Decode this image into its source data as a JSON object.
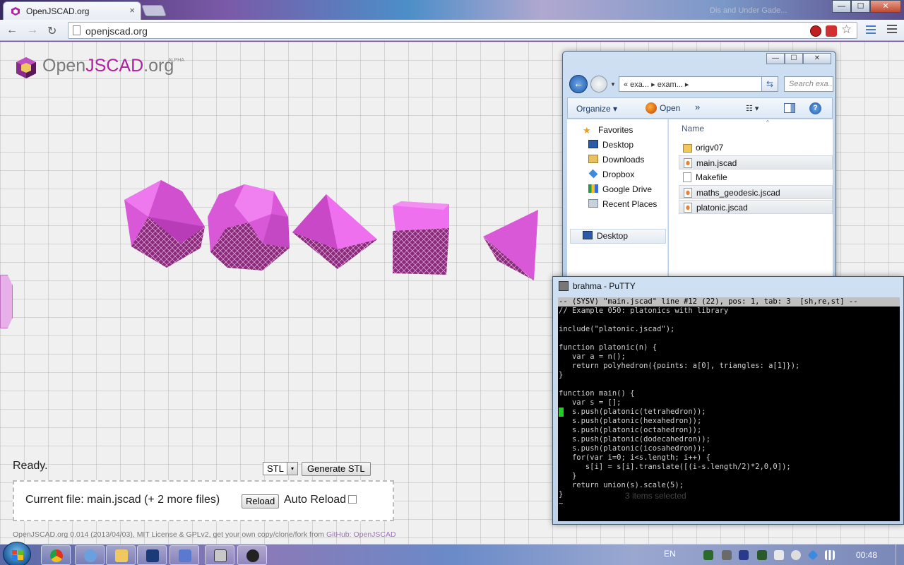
{
  "browser": {
    "tab_title": "OpenJSCAD.org",
    "tab_close": "×",
    "ghost_tab_title": "Dis and Under Gade...",
    "url": "openjscad.org",
    "window_controls": {
      "minimize": "—",
      "maximize": "☐",
      "close": "✕"
    },
    "nav": {
      "back": "←",
      "forward": "→",
      "reload": "↻"
    },
    "star": "☆",
    "extensions": [
      "abp-icon",
      "stop-icon"
    ]
  },
  "app": {
    "logo_prefix": "Open",
    "logo_highlight": "JSCAD",
    "logo_suffix": ".org",
    "logo_badge": "ALPHA",
    "status": "Ready.",
    "format_value": "STL",
    "format_arrow": "▾",
    "generate_label": "Generate STL",
    "current_file": "Current file: main.jscad (+ 2 more files)",
    "reload_label": "Reload",
    "auto_reload_label": "Auto Reload",
    "footer_text": "OpenJSCAD.org 0.014 (2013/04/03), MIT License & GPLv2, get your own copy/clone/fork from ",
    "footer_link": "GitHub: OpenJSCAD",
    "colors": {
      "accent": "#b020a0",
      "shape": "#e060e0"
    }
  },
  "explorer": {
    "controls": {
      "minimize": "—",
      "maximize": "☐",
      "close": "✕"
    },
    "back": "←",
    "address": "«    exa...  ▸   exam...  ▸",
    "refresh": "⇆",
    "search_placeholder": "Search exa...",
    "organize": "Organize ▾",
    "open": "Open",
    "more": "»",
    "views": "☷  ▾",
    "help": "?",
    "nav_items": [
      {
        "label": "Favorites",
        "icon": "star-icon"
      },
      {
        "label": "Desktop",
        "icon": "desktop-icon"
      },
      {
        "label": "Downloads",
        "icon": "downloads-icon"
      },
      {
        "label": "Dropbox",
        "icon": "dropbox-icon"
      },
      {
        "label": "Google Drive",
        "icon": "google-drive-icon"
      },
      {
        "label": "Recent Places",
        "icon": "recent-places-icon"
      },
      {
        "label": "Desktop",
        "icon": "desktop-icon"
      }
    ],
    "column_name": "Name",
    "sort_arrow": "^",
    "files": [
      {
        "name": "origv07",
        "type": "folder"
      },
      {
        "name": "main.jscad",
        "type": "jscad"
      },
      {
        "name": "Makefile",
        "type": "file"
      },
      {
        "name": "maths_geodesic.jscad",
        "type": "jscad"
      },
      {
        "name": "platonic.jscad",
        "type": "jscad"
      }
    ]
  },
  "putty": {
    "title": "brahma - PuTTY",
    "status_line": "-- (SYSV) \"main.jscad\" line #12 (22), pos: 1, tab: 3  [sh,re,st] --",
    "lines": [
      "// Example 050: platonics with library",
      "",
      "include(\"platonic.jscad\");",
      "",
      "function platonic(n) {",
      "   var a = n();",
      "   return polyhedron({points: a[0], triangles: a[1]});",
      "}",
      "",
      "function main() {",
      "   var s = [];",
      "   s.push(platonic(tetrahedron));",
      "   s.push(platonic(hexahedron));",
      "   s.push(platonic(octahedron));",
      "   s.push(platonic(dodecahedron));",
      "   s.push(platonic(icosahedron));",
      "   for(var i=0; i<s.length; i++) {",
      "      s[i] = s[i].translate([(i-s.length/2)*2,0,0]);",
      "   }",
      "   return union(s).scale(5);",
      "}",
      "~"
    ],
    "ghost_text": "3 items selected"
  },
  "taskbar": {
    "apps": [
      "chrome-icon",
      "network-icon",
      "explorer-folder-icon",
      "app-icon",
      "virtualbox-icon",
      "putty-icon",
      "bug-icon"
    ],
    "language": "EN",
    "clock": "00:48"
  }
}
